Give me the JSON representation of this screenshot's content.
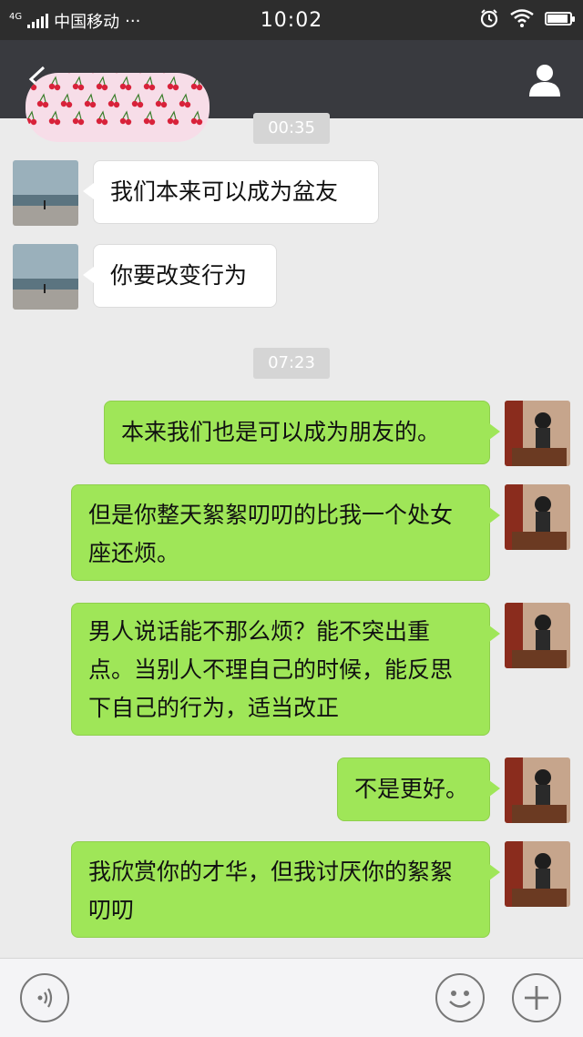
{
  "status_bar": {
    "network_type": "4G",
    "carrier": "中国移动",
    "dots": "···",
    "time": "10:02",
    "battery_level": 0.9
  },
  "chat": {
    "timestamps": [
      "00:35",
      "07:23"
    ],
    "messages": [
      {
        "from": "contact",
        "text": "我们本来可以成为盆友"
      },
      {
        "from": "contact",
        "text": "你要改变行为"
      },
      {
        "from": "me",
        "text": "本来我们也是可以成为朋友的。"
      },
      {
        "from": "me",
        "text": "但是你整天絮絮叨叨的比我一个处女座还烦。"
      },
      {
        "from": "me",
        "text": "男人说话能不那么烦？能不突出重点。当别人不理自己的时候，能反思下自己的行为，适当改正"
      },
      {
        "from": "me",
        "text": "不是更好。"
      },
      {
        "from": "me",
        "text": "我欣赏你的才华，但我讨厌你的絮絮叨叨"
      }
    ]
  },
  "colors": {
    "title_bar": "#393a3f",
    "status_bar": "#2d2d2d",
    "chat_bg": "#ebebeb",
    "outgoing_bubble": "#9fe658",
    "incoming_bubble": "#ffffff"
  },
  "icons": {
    "back": "back-arrow-icon",
    "contact": "person-icon",
    "voice": "voice-icon",
    "emoji": "emoji-icon",
    "more": "plus-icon"
  }
}
